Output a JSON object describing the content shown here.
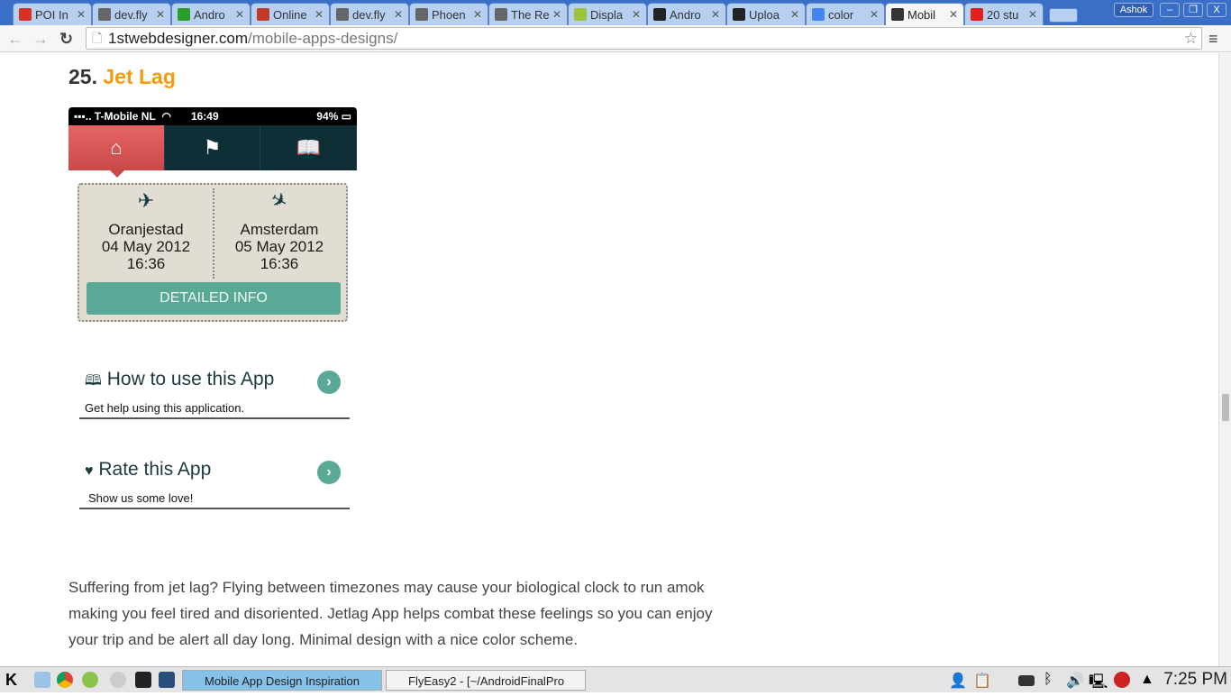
{
  "browser": {
    "tabs": [
      {
        "label": "POI In",
        "icon": "gmail-icon",
        "color": "#d93025"
      },
      {
        "label": "dev.fly",
        "icon": "page-icon",
        "color": "#666"
      },
      {
        "label": "Andro",
        "icon": "android-monster-icon",
        "color": "#2a9d2a"
      },
      {
        "label": "Online",
        "icon": "opera-icon",
        "color": "#c0392b"
      },
      {
        "label": "dev.fly",
        "icon": "page-icon",
        "color": "#666"
      },
      {
        "label": "Phoen",
        "icon": "page-icon",
        "color": "#666"
      },
      {
        "label": "The Re",
        "icon": "page-icon",
        "color": "#666"
      },
      {
        "label": "Displa",
        "icon": "android-icon",
        "color": "#9bc43a"
      },
      {
        "label": "Andro",
        "icon": "github-icon",
        "color": "#222"
      },
      {
        "label": "Uploa",
        "icon": "github-icon",
        "color": "#222"
      },
      {
        "label": "color",
        "icon": "google-icon",
        "color": "#4285f4"
      },
      {
        "label": "Mobil",
        "icon": "1stwebdesigner-icon",
        "color": "#333"
      },
      {
        "label": "20 stu",
        "icon": "e-icon",
        "color": "#e32020"
      }
    ],
    "user": "Ashok",
    "url_domain": "1stwebdesigner.com",
    "url_path": "/mobile-apps-designs/"
  },
  "article": {
    "number": "25.",
    "title": "Jet Lag",
    "accent": "#f39c12",
    "paragraph": "Suffering from jet lag? Flying between timezones may cause your biological clock to run amok making you feel tired and disoriented. Jetlag App helps combat these feelings so you can enjoy your trip and be alert all day long. Minimal design with a nice color scheme."
  },
  "app": {
    "carrier": "T-Mobile NL",
    "time": "16:49",
    "battery": "94%",
    "from": {
      "city": "Oranjestad",
      "date": "04 May 2012",
      "time": "16:36"
    },
    "to": {
      "city": "Amsterdam",
      "date": "05 May 2012",
      "time": "16:36"
    },
    "detail_button": "DETAILED INFO",
    "rows": [
      {
        "title": "How to use this App",
        "subtitle": "Get help using this application."
      },
      {
        "title": "Rate this App",
        "subtitle": "Show us some love!"
      }
    ]
  },
  "taskbar": {
    "tasks": [
      "Mobile App Design Inspiration",
      "FlyEasy2 - [~/AndroidFinalPro"
    ],
    "clock": "7:25 PM"
  }
}
